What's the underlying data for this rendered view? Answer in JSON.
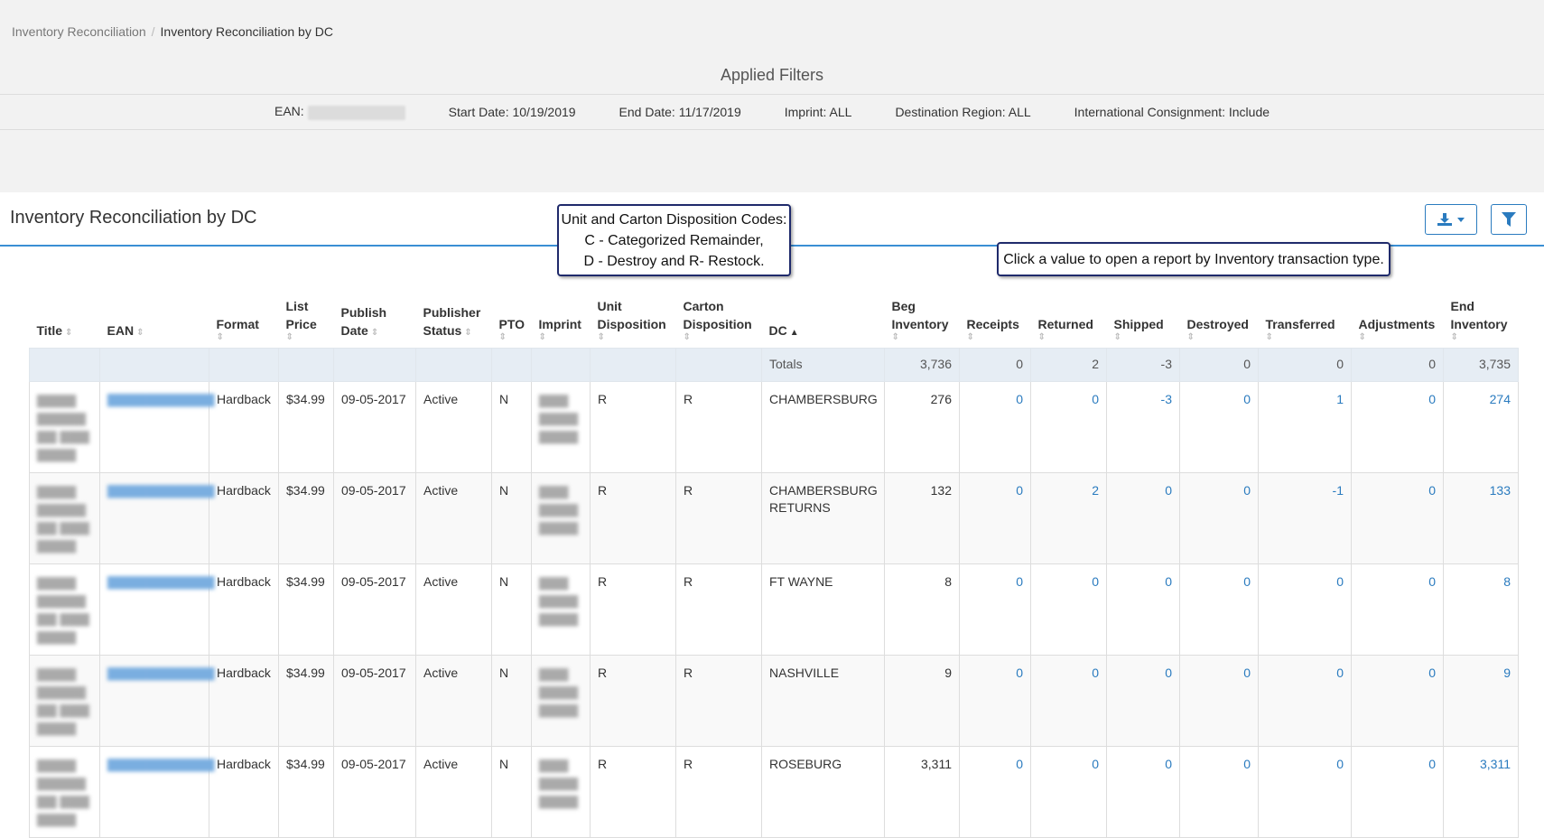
{
  "breadcrumb": {
    "parent": "Inventory Reconciliation",
    "current": "Inventory Reconciliation by DC"
  },
  "filters": {
    "title": "Applied Filters",
    "ean_label": "EAN:",
    "start_date": "Start Date: 10/19/2019",
    "end_date": "End Date: 11/17/2019",
    "imprint": "Imprint: ALL",
    "region": "Destination Region: ALL",
    "consignment": "International Consignment: Include"
  },
  "panel": {
    "title": "Inventory Reconciliation by DC"
  },
  "callouts": {
    "codes_l1": "Unit and Carton Disposition Codes:",
    "codes_l2": "C - Categorized Remainder,",
    "codes_l3": "D - Destroy and R- Restock.",
    "click_hint": "Click a value to open a report by Inventory transaction type."
  },
  "colors": {
    "accent": "#2a7bbf",
    "totals_bg": "#e6edf4",
    "callout_border": "#1f2a6b"
  },
  "table": {
    "headers": {
      "title": "Title",
      "ean": "EAN",
      "format": "Format",
      "list_price_1": "List",
      "list_price_2": "Price",
      "publish_1": "Publish",
      "publish_2": "Date",
      "status_1": "Publisher",
      "status_2": "Status",
      "pto": "PTO",
      "imprint": "Imprint",
      "unit_1": "Unit",
      "unit_2": "Disposition",
      "carton_1": "Carton",
      "carton_2": "Disposition",
      "dc": "DC",
      "beg_1": "Beg",
      "beg_2": "Inventory",
      "receipts": "Receipts",
      "returned": "Returned",
      "shipped": "Shipped",
      "destroyed": "Destroyed",
      "transferred": "Transferred",
      "adjustments": "Adjustments",
      "end_1": "End",
      "end_2": "Inventory"
    },
    "totals": {
      "label": "Totals",
      "beg": "3,736",
      "receipts": "0",
      "returned": "2",
      "shipped": "-3",
      "destroyed": "0",
      "transferred": "0",
      "adjustments": "0",
      "end": "3,735"
    },
    "rows": [
      {
        "format": "Hardback",
        "price": "$34.99",
        "date": "09-05-2017",
        "status": "Active",
        "pto": "N",
        "unit": "R",
        "carton": "R",
        "dc": "CHAMBERSBURG",
        "beg": "276",
        "receipts": "0",
        "returned": "0",
        "shipped": "-3",
        "destroyed": "0",
        "transferred": "1",
        "adjustments": "0",
        "end": "274"
      },
      {
        "format": "Hardback",
        "price": "$34.99",
        "date": "09-05-2017",
        "status": "Active",
        "pto": "N",
        "unit": "R",
        "carton": "R",
        "dc": "CHAMBERSBURG RETURNS",
        "beg": "132",
        "receipts": "0",
        "returned": "2",
        "shipped": "0",
        "destroyed": "0",
        "transferred": "-1",
        "adjustments": "0",
        "end": "133"
      },
      {
        "format": "Hardback",
        "price": "$34.99",
        "date": "09-05-2017",
        "status": "Active",
        "pto": "N",
        "unit": "R",
        "carton": "R",
        "dc": "FT WAYNE",
        "beg": "8",
        "receipts": "0",
        "returned": "0",
        "shipped": "0",
        "destroyed": "0",
        "transferred": "0",
        "adjustments": "0",
        "end": "8"
      },
      {
        "format": "Hardback",
        "price": "$34.99",
        "date": "09-05-2017",
        "status": "Active",
        "pto": "N",
        "unit": "R",
        "carton": "R",
        "dc": "NASHVILLE",
        "beg": "9",
        "receipts": "0",
        "returned": "0",
        "shipped": "0",
        "destroyed": "0",
        "transferred": "0",
        "adjustments": "0",
        "end": "9"
      },
      {
        "format": "Hardback",
        "price": "$34.99",
        "date": "09-05-2017",
        "status": "Active",
        "pto": "N",
        "unit": "R",
        "carton": "R",
        "dc": "ROSEBURG",
        "beg": "3,311",
        "receipts": "0",
        "returned": "0",
        "shipped": "0",
        "destroyed": "0",
        "transferred": "0",
        "adjustments": "0",
        "end": "3,311"
      }
    ]
  }
}
